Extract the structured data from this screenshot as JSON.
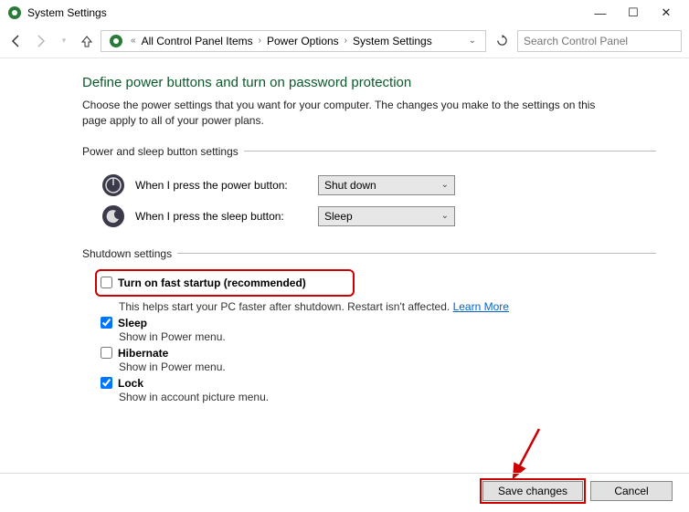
{
  "window": {
    "title": "System Settings"
  },
  "breadcrumb": {
    "item1": "All Control Panel Items",
    "item2": "Power Options",
    "item3": "System Settings"
  },
  "search": {
    "placeholder": "Search Control Panel"
  },
  "heading": "Define power buttons and turn on password protection",
  "subtext": "Choose the power settings that you want for your computer. The changes you make to the settings on this page apply to all of your power plans.",
  "sections": {
    "buttons": {
      "legend": "Power and sleep button settings",
      "power_label": "When I press the power button:",
      "power_value": "Shut down",
      "sleep_label": "When I press the sleep button:",
      "sleep_value": "Sleep"
    },
    "shutdown": {
      "legend": "Shutdown settings",
      "fast_startup": {
        "label": "Turn on fast startup (recommended)",
        "desc_prefix": "This helps start your PC faster after shutdown. Restart isn't affected. ",
        "learn_more": "Learn More",
        "checked": false
      },
      "sleep": {
        "label": "Sleep",
        "desc": "Show in Power menu.",
        "checked": true
      },
      "hibernate": {
        "label": "Hibernate",
        "desc": "Show in Power menu.",
        "checked": false
      },
      "lock": {
        "label": "Lock",
        "desc": "Show in account picture menu.",
        "checked": true
      }
    }
  },
  "footer": {
    "save": "Save changes",
    "cancel": "Cancel"
  }
}
